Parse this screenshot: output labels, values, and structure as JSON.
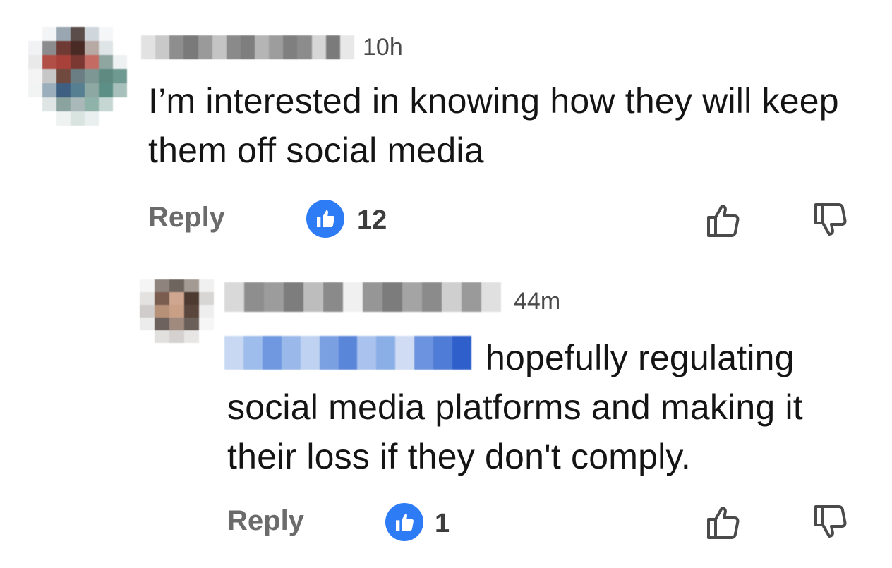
{
  "comment": {
    "timestamp": "10h",
    "text": "I’m interested in knowing how they will keep them off social media",
    "reply_label": "Reply",
    "like_count": "12"
  },
  "reply": {
    "timestamp": "44m",
    "text_line1": "hopefully regulating",
    "text_rest": "social media platforms and making it their loss if they don't comply.",
    "reply_label": "Reply",
    "like_count": "1"
  },
  "colors": {
    "like_badge": "#2d7cf6",
    "reply_label": "#6b6b6b",
    "text": "#141414"
  },
  "icons": [
    "thumbs-up-icon",
    "thumbs-down-icon",
    "like-reaction-icon"
  ]
}
